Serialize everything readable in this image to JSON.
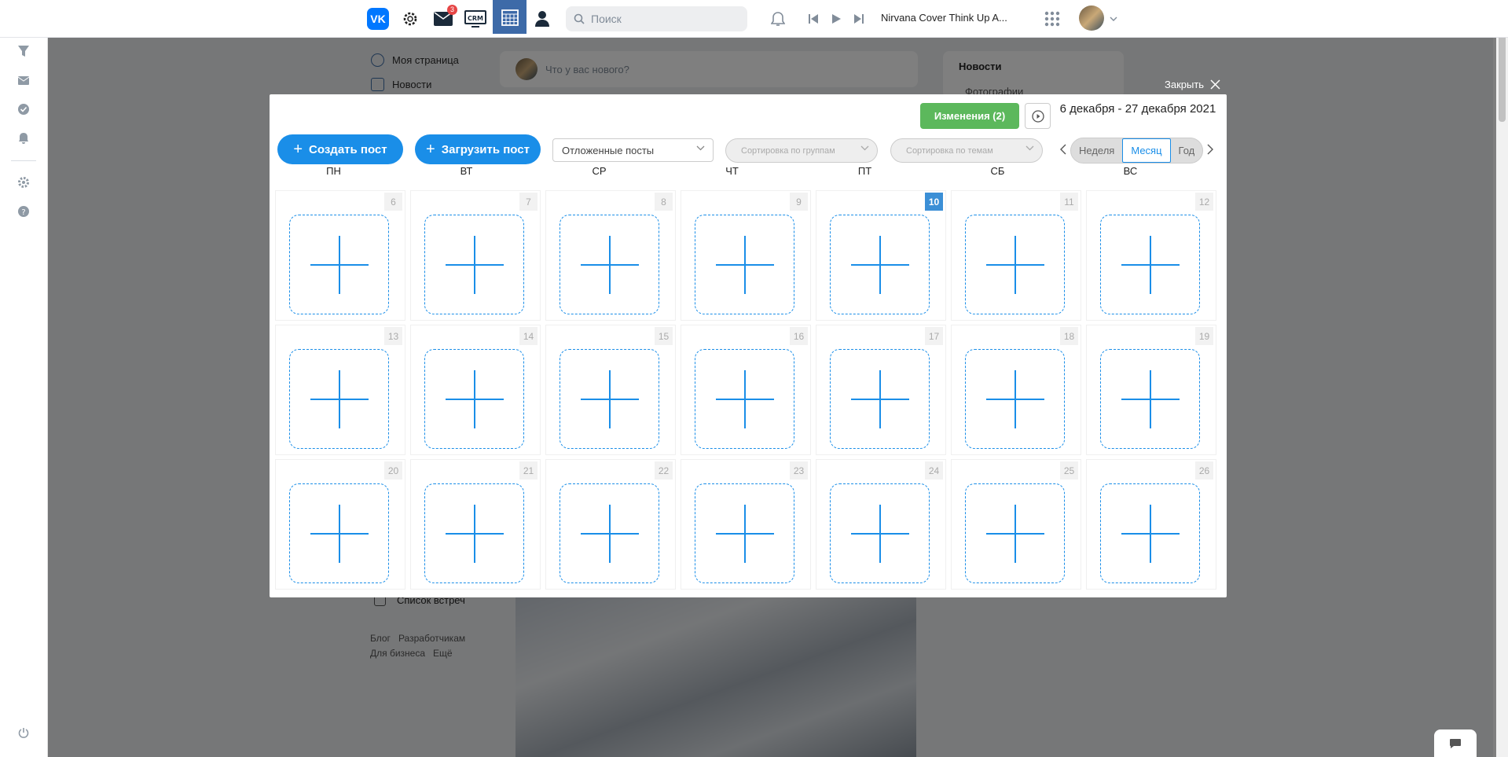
{
  "header": {
    "notif_badge": "3",
    "search_placeholder": "Поиск",
    "player_track": "Nirvana Cover Think Up A..."
  },
  "left_menu": {
    "items": [
      "Моя страница",
      "Новости"
    ],
    "meetings": "Список встреч",
    "footer_links": [
      "Блог",
      "Разработчикам",
      "Для бизнеса",
      "Ещё"
    ]
  },
  "composer": {
    "placeholder": "Что у вас нового?"
  },
  "right_panel": {
    "title": "Новости",
    "sub": "Фотографии"
  },
  "close_label": "Закрыть",
  "modal": {
    "changes_label": "Изменения (2)",
    "date_range": "6 декабря - 27 декабря 2021",
    "create_post": "Создать пост",
    "upload_post": "Загрузить пост",
    "posts_filter": "Отложенные посты",
    "sort_groups": "Сортировка по группам",
    "sort_topics": "Сортировка по темам",
    "view_modes": [
      "Неделя",
      "Месяц",
      "Год"
    ],
    "active_view": "Месяц",
    "weekdays": [
      "ПН",
      "ВТ",
      "СР",
      "ЧТ",
      "ПТ",
      "СБ",
      "ВС"
    ],
    "today": 10,
    "weeks": [
      [
        6,
        7,
        8,
        9,
        10,
        11,
        12
      ],
      [
        13,
        14,
        15,
        16,
        17,
        18,
        19
      ],
      [
        20,
        21,
        22,
        23,
        24,
        25,
        26
      ]
    ]
  },
  "colors": {
    "primary": "#1a8ee8",
    "success": "#5cb85c",
    "vk_blue": "#0077ff",
    "today_badge": "#3b8fd6"
  }
}
